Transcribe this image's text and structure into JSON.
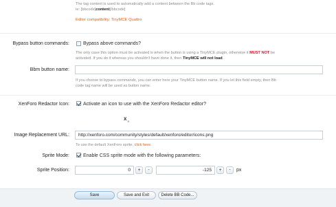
{
  "content_hint": {
    "line1": "The tag content is used to automatically add a content between the Bb code tags.",
    "line2_prefix": "Ie: [bbcode]",
    "line2_bold": "content",
    "line2_suffix": "[/bbcode]"
  },
  "editor_compat": "Editor compatibility: TinyMCE Quattro",
  "bypass": {
    "label": "Bypass button commands:",
    "checkbox_label": "Bypass above commands?",
    "checked": false,
    "hint_part1": "The only case this option must be activated is when the button is using a TinyMCE plugin, otherwise it ",
    "hint_must_not": "MUST NOT",
    "hint_part2": " be",
    "hint_line2_part1": "activated. If you do it whereas you shouldn't have done it, then ",
    "hint_will_not_load": "TinyMCE will not load",
    "hint_line2_end": "."
  },
  "bbm_name": {
    "label": "Bbm button name:",
    "value": "",
    "hint_line1": "If you choose to bypass commands, you can enter here your TinyMCE button name. If you let this field empty, then Bb",
    "hint_line2": "code tag name will be used as button name."
  },
  "redactor": {
    "label": "XenForo Redactor Icon:",
    "checkbox_label": "Activate an icon to use with the XenForo Redactor editor?",
    "checked": true,
    "preview_icon": "clear-format-icon"
  },
  "image_url": {
    "label": "Image Replacement URL:",
    "value": "http://xenforo.com/community/styles/default/xenforo/editor/icons.png",
    "hint_prefix": "To use the default XenForo sprite, ",
    "hint_link": "click here",
    "hint_suffix": "."
  },
  "sprite_mode": {
    "label": "Sprite Mode:",
    "checkbox_label": "Enable CSS sprite mode with the following parameters:",
    "checked": true
  },
  "sprite_position": {
    "label": "Sprite Position:",
    "x": "0",
    "y": "-125",
    "plus": "+",
    "minus": "-",
    "unit": "px"
  },
  "buttons": {
    "save": "Save",
    "save_exit": "Save and Exit",
    "delete": "Delete BB Code..."
  },
  "colors": {
    "accent_orange": "#e0651c",
    "warning_red": "#d4142a",
    "field_border": "#c5cfd9"
  }
}
